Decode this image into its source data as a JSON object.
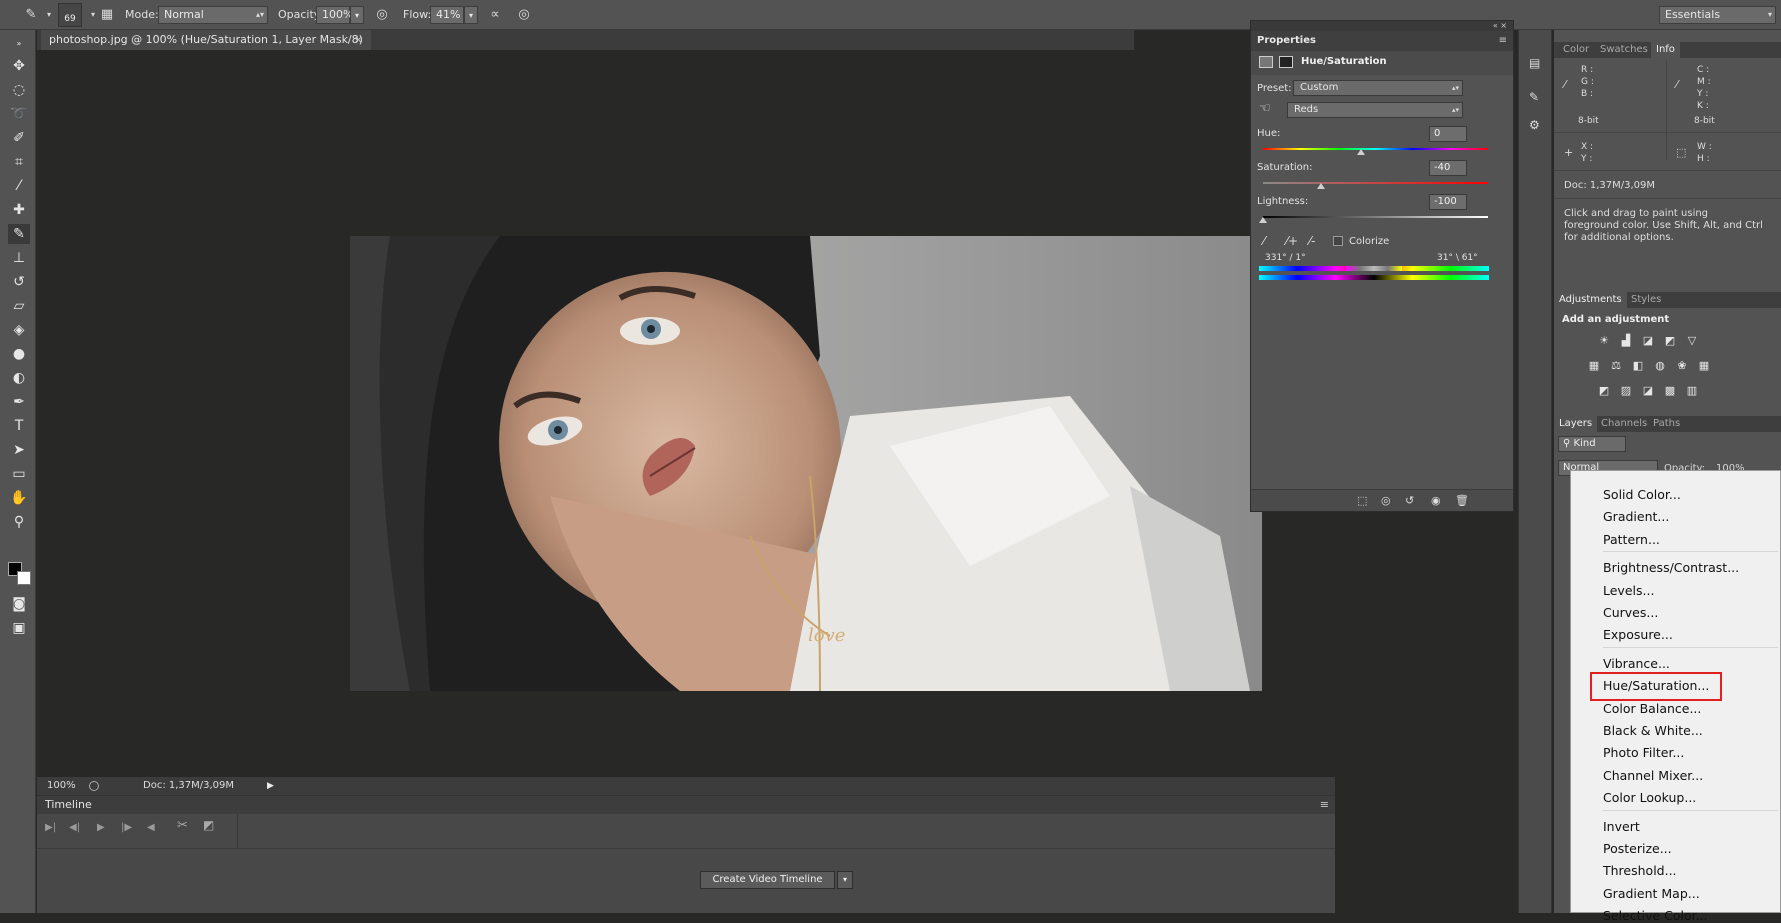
{
  "options_bar": {
    "brush_size": "69",
    "mode_label": "Mode:",
    "mode_value": "Normal",
    "opacity_label": "Opacity:",
    "opacity_value": "100%",
    "flow_label": "Flow:",
    "flow_value": "41%",
    "workspace": "Essentials"
  },
  "document": {
    "tab_title": "photoshop.jpg @ 100% (Hue/Saturation 1, Layer Mask/8) *",
    "zoom": "100%",
    "doc_size": "Doc: 1,37M/3,09M"
  },
  "timeline": {
    "title": "Timeline",
    "create_button": "Create Video Timeline"
  },
  "properties": {
    "title": "Properties",
    "adjustment": "Hue/Saturation",
    "preset_label": "Preset:",
    "preset_value": "Custom",
    "channel_value": "Reds",
    "hue_label": "Hue:",
    "hue_value": "0",
    "saturation_label": "Saturation:",
    "saturation_value": "-40",
    "lightness_label": "Lightness:",
    "lightness_value": "-100",
    "colorize_label": "Colorize",
    "range_left": "331° / 1°",
    "range_right": "31° \\ 61°"
  },
  "info_panel": {
    "tabs": [
      "Color",
      "Swatches",
      "Info"
    ],
    "r": "R :",
    "g": "G :",
    "b": "B :",
    "c": "C :",
    "m": "M :",
    "y": "Y :",
    "k": "K :",
    "bit_left": "8-bit",
    "bit_right": "8-bit",
    "x": "X :",
    "y2": "Y :",
    "w": "W :",
    "h": "H :",
    "doc": "Doc: 1,37M/3,09M",
    "hint": "Click and drag to paint using foreground color.  Use Shift, Alt, and Ctrl for additional options."
  },
  "adjustments_panel": {
    "tabs": [
      "Adjustments",
      "Styles"
    ],
    "heading": "Add an adjustment"
  },
  "layers_panel": {
    "tabs": [
      "Layers",
      "Channels",
      "Paths"
    ],
    "kind": "Kind",
    "blend": "Normal",
    "opacity_label": "Opacity:",
    "opacity_value": "100%"
  },
  "menu": {
    "groups": [
      [
        "Solid Color...",
        "Gradient...",
        "Pattern..."
      ],
      [
        "Brightness/Contrast...",
        "Levels...",
        "Curves...",
        "Exposure..."
      ],
      [
        "Vibrance...",
        "Hue/Saturation...",
        "Color Balance...",
        "Black & White...",
        "Photo Filter...",
        "Channel Mixer...",
        "Color Lookup..."
      ],
      [
        "Invert",
        "Posterize...",
        "Threshold...",
        "Gradient Map...",
        "Selective Color..."
      ]
    ],
    "highlighted": "Hue/Saturation..."
  },
  "colors": {
    "panel_bg": "#535353",
    "canvas_bg": "#282826",
    "highlight_border": "#e02020"
  }
}
